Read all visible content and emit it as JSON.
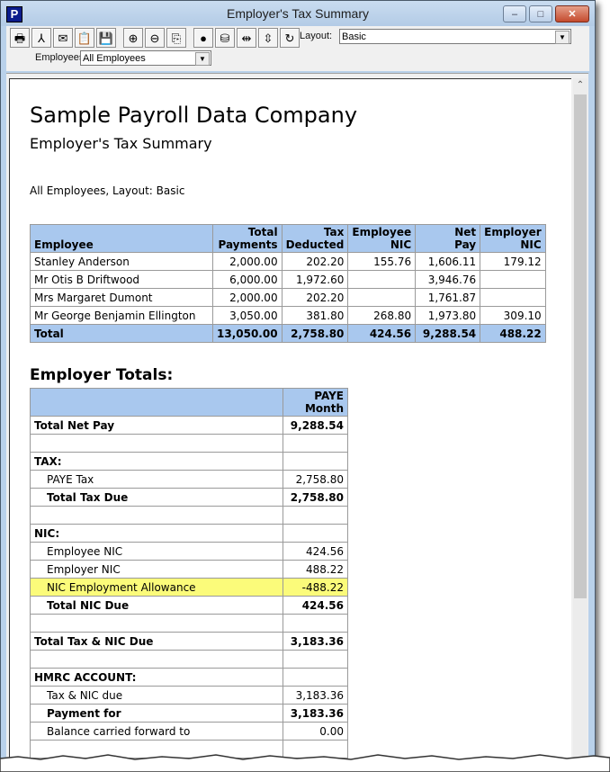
{
  "window": {
    "title": "Employer's Tax Summary",
    "app_icon_letter": "P",
    "controls": {
      "minimize": "–",
      "maximize": "□",
      "close": "✕"
    }
  },
  "toolbar": {
    "buttons": [
      {
        "name": "print",
        "icon": "printer-icon",
        "glyph": "🖶"
      },
      {
        "name": "pdf",
        "icon": "pdf-icon",
        "glyph": "⅄"
      },
      {
        "name": "email",
        "icon": "email-icon",
        "glyph": "✉"
      },
      {
        "name": "clipboard",
        "icon": "clipboard-icon",
        "glyph": "📋"
      },
      {
        "name": "save",
        "icon": "save-icon",
        "glyph": "💾"
      },
      {
        "name": "zoom-in",
        "icon": "zoom-in-icon",
        "glyph": "⊕"
      },
      {
        "name": "zoom-out",
        "icon": "zoom-out-icon",
        "glyph": "⊖"
      },
      {
        "name": "page-setup",
        "icon": "page-setup-icon",
        "glyph": "⎘"
      },
      {
        "name": "colors",
        "icon": "colors-icon",
        "glyph": "●"
      },
      {
        "name": "coins",
        "icon": "coins-icon",
        "glyph": "⛁"
      },
      {
        "name": "column-width",
        "icon": "column-width-icon",
        "glyph": "⇹"
      },
      {
        "name": "row-height",
        "icon": "row-height-icon",
        "glyph": "⇳"
      },
      {
        "name": "refresh",
        "icon": "refresh-icon",
        "glyph": "↻"
      }
    ],
    "layout_label": "Layout:",
    "layout_value": "Basic",
    "employees_label": "Employees:",
    "employees_value": "All Employees"
  },
  "report": {
    "company": "Sample Payroll Data Company",
    "title": "Employer's Tax Summary",
    "filter_line": "All Employees, Layout: Basic",
    "employee_table": {
      "headers": [
        [
          "",
          "Employee"
        ],
        [
          "Total",
          "Payments"
        ],
        [
          "Tax",
          "Deducted"
        ],
        [
          "Employee",
          "NIC"
        ],
        [
          "Net",
          "Pay"
        ],
        [
          "Employer",
          "NIC"
        ]
      ],
      "rows": [
        [
          "Stanley Anderson",
          "2,000.00",
          "202.20",
          "155.76",
          "1,606.11",
          "179.12"
        ],
        [
          "Mr Otis B Driftwood",
          "6,000.00",
          "1,972.60",
          "",
          "3,946.76",
          ""
        ],
        [
          "Mrs Margaret Dumont",
          "2,000.00",
          "202.20",
          "",
          "1,761.87",
          ""
        ],
        [
          "Mr George Benjamin Ellington",
          "3,050.00",
          "381.80",
          "268.80",
          "1,973.80",
          "309.10"
        ]
      ],
      "total": [
        "Total",
        "13,050.00",
        "2,758.80",
        "424.56",
        "9,288.54",
        "488.22"
      ]
    },
    "employer_totals": {
      "title": "Employer Totals:",
      "header": [
        "",
        "PAYE",
        "Month"
      ],
      "rows": [
        {
          "label": "Total Net Pay",
          "value": "9,288.54",
          "bold": true,
          "indent": false
        },
        {
          "label": "",
          "value": "",
          "bold": false,
          "indent": false
        },
        {
          "label": "TAX:",
          "value": "",
          "bold": true,
          "indent": false
        },
        {
          "label": "PAYE Tax",
          "value": "2,758.80",
          "bold": false,
          "indent": true
        },
        {
          "label": "Total Tax Due",
          "value": "2,758.80",
          "bold": true,
          "indent": true
        },
        {
          "label": "",
          "value": "",
          "bold": false,
          "indent": false
        },
        {
          "label": "NIC:",
          "value": "",
          "bold": true,
          "indent": false
        },
        {
          "label": "Employee NIC",
          "value": "424.56",
          "bold": false,
          "indent": true
        },
        {
          "label": "Employer NIC",
          "value": "488.22",
          "bold": false,
          "indent": true
        },
        {
          "label": "NIC Employment Allowance",
          "value": "-488.22",
          "bold": false,
          "indent": true,
          "highlight": true
        },
        {
          "label": "Total NIC Due",
          "value": "424.56",
          "bold": true,
          "indent": true
        },
        {
          "label": "",
          "value": "",
          "bold": false,
          "indent": false
        },
        {
          "label": "Total Tax & NIC Due",
          "value": "3,183.36",
          "bold": true,
          "indent": false
        },
        {
          "label": "",
          "value": "",
          "bold": false,
          "indent": false
        },
        {
          "label": "HMRC ACCOUNT:",
          "value": "",
          "bold": true,
          "indent": false
        },
        {
          "label": "Tax & NIC due",
          "value": "3,183.36",
          "bold": false,
          "indent": true
        },
        {
          "label": "Payment for",
          "value": "3,183.36",
          "bold": true,
          "indent": true
        },
        {
          "label": "Balance carried forward to",
          "value": "0.00",
          "bold": false,
          "indent": true
        },
        {
          "label": "",
          "value": "",
          "bold": false,
          "indent": false
        }
      ]
    }
  },
  "colors": {
    "header_fill": "#a9c8ee",
    "highlight": "#fbfb7a"
  }
}
